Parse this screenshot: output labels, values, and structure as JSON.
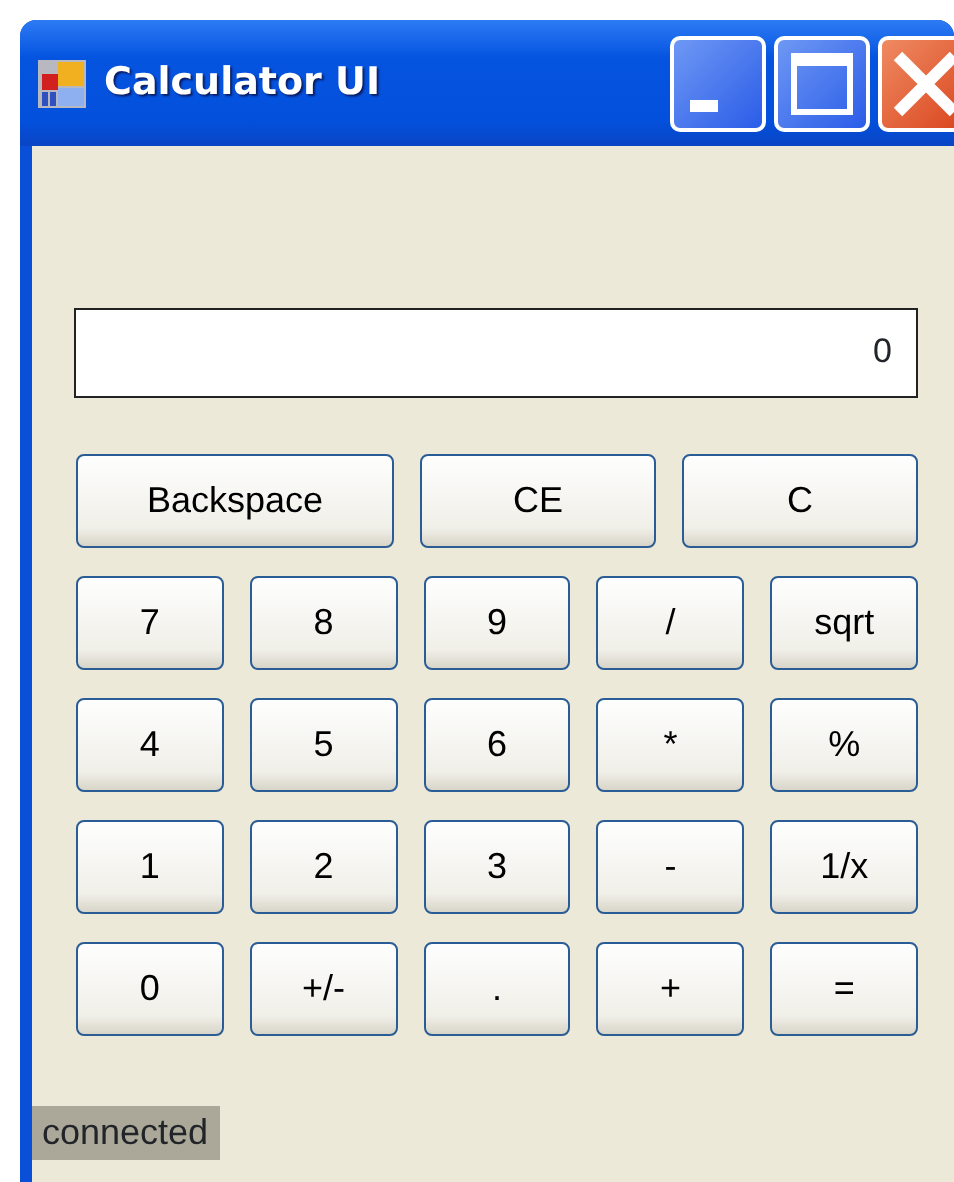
{
  "window": {
    "title": "Calculator UI"
  },
  "display": {
    "value": "0"
  },
  "top_buttons": [
    "Backspace",
    "CE",
    "C"
  ],
  "keypad": [
    [
      "7",
      "8",
      "9",
      "/",
      "sqrt"
    ],
    [
      "4",
      "5",
      "6",
      "*",
      "%"
    ],
    [
      "1",
      "2",
      "3",
      "-",
      "1/x"
    ],
    [
      "0",
      "+/-",
      ".",
      "+",
      "="
    ]
  ],
  "status_bar": {
    "text": "connected"
  }
}
